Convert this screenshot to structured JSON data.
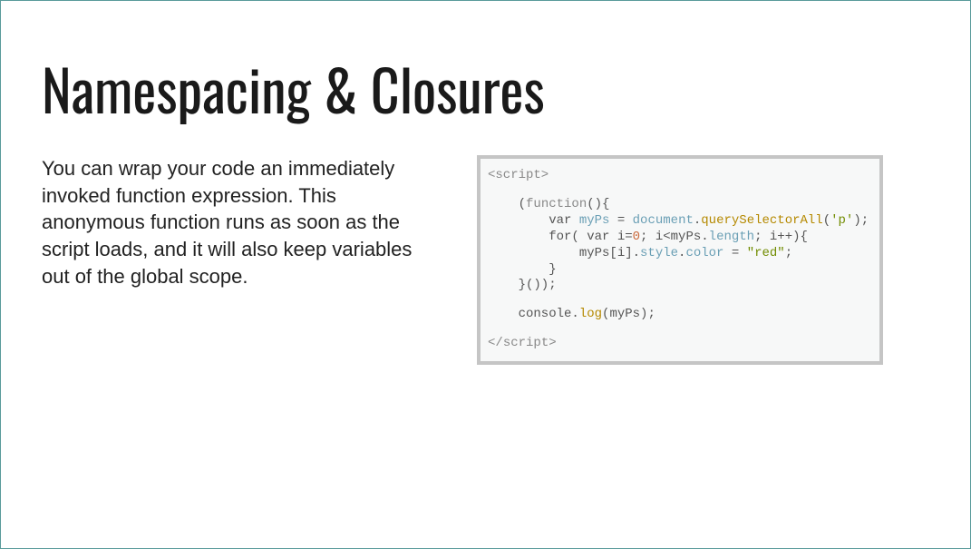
{
  "slide": {
    "title": "Namespacing & Closures",
    "body": "You can wrap your code an immediately invoked function expression. This anonymous function runs as soon as the script loads, and it will also keep variables out of the global scope.",
    "code": {
      "open_tag": "<script>",
      "line1_a": "    (",
      "line1_b": "function",
      "line1_c": "(){",
      "line2_a": "        var ",
      "line2_b": "myPs",
      "line2_c": " = ",
      "line2_d": "document",
      "line2_e": ".",
      "line2_f": "querySelectorAll",
      "line2_g": "(",
      "line2_h": "'p'",
      "line2_i": ");",
      "line3_a": "        for( var i=",
      "line3_b": "0",
      "line3_c": "; i<myPs.",
      "line3_d": "length",
      "line3_e": "; i++){",
      "line4_a": "            myPs[i].",
      "line4_b": "style",
      "line4_c": ".",
      "line4_d": "color",
      "line4_e": " = ",
      "line4_f": "\"red\"",
      "line4_g": ";",
      "line5": "        }",
      "line6": "    }());",
      "line7_a": "    console.",
      "line7_b": "log",
      "line7_c": "(myPs);",
      "close_tag_open": "</",
      "close_tag_name": "script",
      "close_tag_close": ">"
    }
  }
}
